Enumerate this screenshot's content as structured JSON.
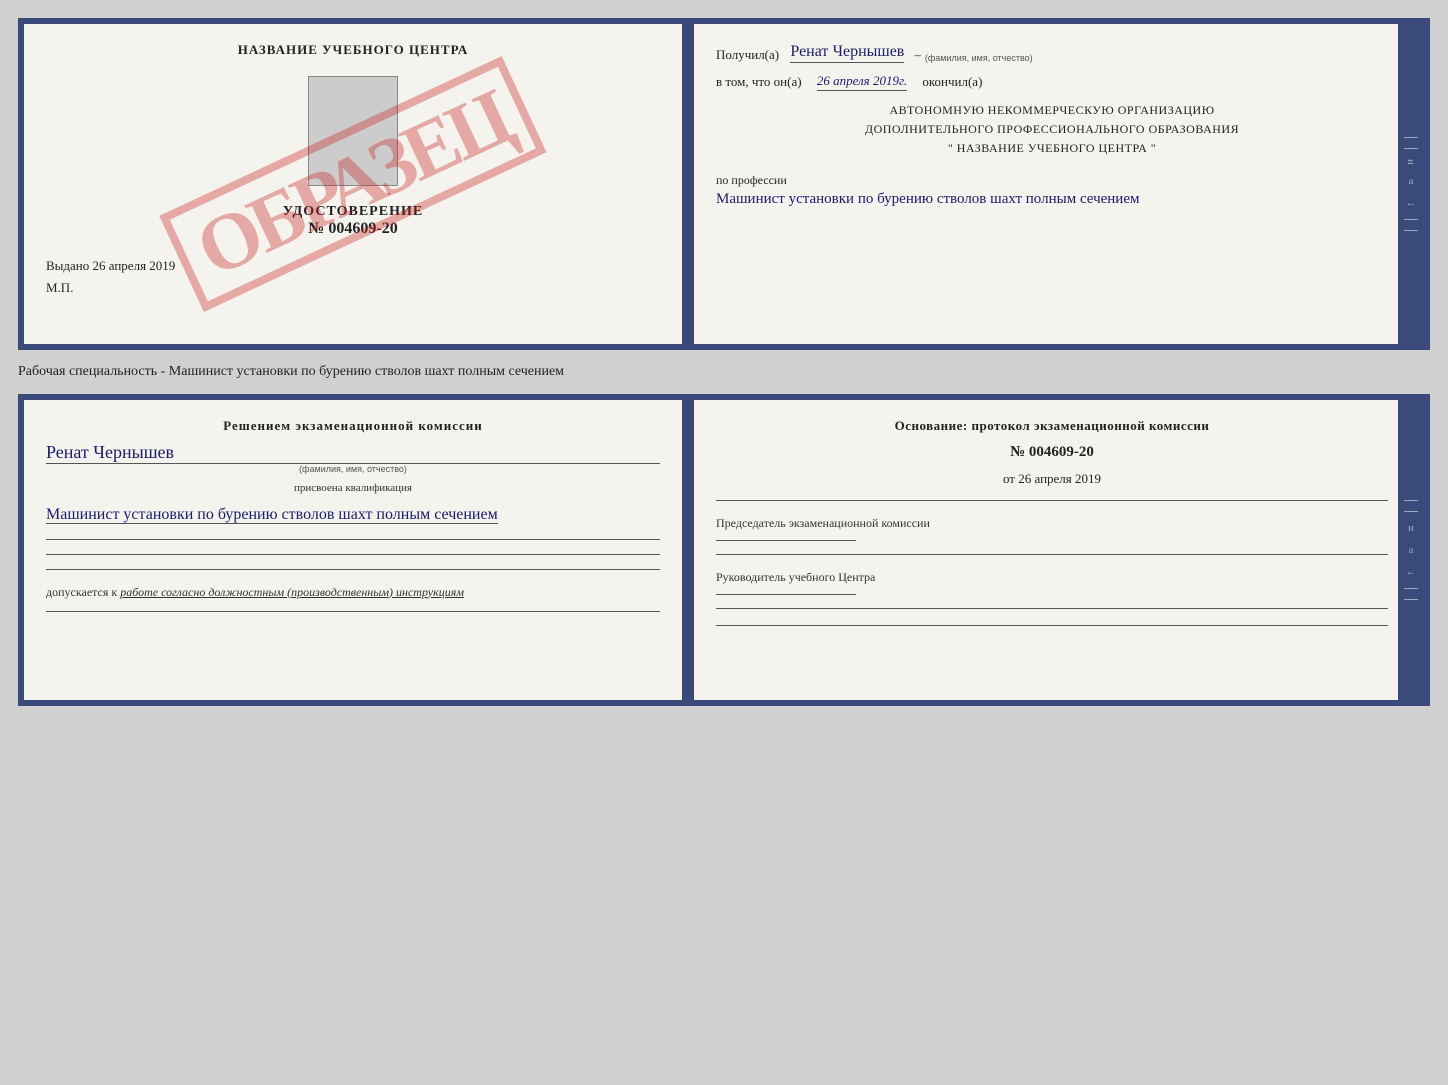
{
  "top_doc": {
    "left": {
      "title": "НАЗВАНИЕ УЧЕБНОГО ЦЕНТРА",
      "stamp_text": "ОБРАЗЕЦ",
      "udostoverenie_label": "УДОСТОВЕРЕНИЕ",
      "number": "№ 004609-20",
      "vydano_label": "Выдано",
      "vydano_date": "26 апреля 2019",
      "mp_label": "М.П."
    },
    "right": {
      "poluchil_label": "Получил(а)",
      "fio": "Ренат Чернышев",
      "fio_sub": "(фамилия, имя, отчество)",
      "dash": "–",
      "vtom_label": "в том, что он(а)",
      "date": "26 апреля 2019г.",
      "okonchil_label": "окончил(а)",
      "org_line1": "АВТОНОМНУЮ НЕКОММЕРЧЕСКУЮ ОРГАНИЗАЦИЮ",
      "org_line2": "ДОПОЛНИТЕЛЬНОГО ПРОФЕССИОНАЛЬНОГО ОБРАЗОВАНИЯ",
      "org_line3": "\" НАЗВАНИЕ УЧЕБНОГО ЦЕНТРА \"",
      "po_professii_label": "по профессии",
      "profession": "Машинист установки по бурению стволов шахт полным сечением",
      "spine_letters": [
        "и",
        "а",
        "←"
      ]
    }
  },
  "middle_label": "Рабочая специальность - Машинист установки по бурению стволов шахт полным сечением",
  "bottom_doc": {
    "left": {
      "resheniem_label": "Решением экзаменационной комиссии",
      "fio": "Ренат Чернышев",
      "fio_sub": "(фамилия, имя, отчество)",
      "prisvoena_label": "присвоена квалификация",
      "kvali": "Машинист установки по бурению стволов шахт полным сечением",
      "dopuskaetsya_label": "допускается к",
      "dopusk_text": "работе согласно должностным (производственным) инструкциям"
    },
    "right": {
      "osnovanie_label": "Основание: протокол экзаменационной комиссии",
      "number": "№ 004609-20",
      "ot_label": "от",
      "ot_date": "26 апреля 2019",
      "predsedatel_label": "Председатель экзаменационной комиссии",
      "rukovoditel_label": "Руководитель учебного Центра",
      "spine_letters": [
        "и",
        "а",
        "←"
      ]
    }
  }
}
